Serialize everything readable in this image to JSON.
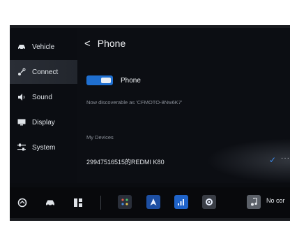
{
  "sidebar": {
    "items": [
      {
        "label": "Vehicle",
        "icon": "car-icon"
      },
      {
        "label": "Connect",
        "icon": "connect-icon",
        "active": true
      },
      {
        "label": "Sound",
        "icon": "speaker-icon"
      },
      {
        "label": "Display",
        "icon": "display-icon"
      },
      {
        "label": "System",
        "icon": "sliders-icon"
      }
    ]
  },
  "header": {
    "back_glyph": "<",
    "title": "Phone"
  },
  "phone": {
    "toggle_label": "Phone",
    "toggle_on": true,
    "discoverable_text": "Now discoverable as 'CFMOTO-8Nw6K7'"
  },
  "devices": {
    "section_label": "My Devices",
    "items": [
      {
        "name": "29947516515的REDMI K80",
        "connected": true,
        "more": "···"
      }
    ]
  },
  "dock": {
    "items": [
      "home-icon",
      "car-icon",
      "grid-icon"
    ],
    "apps": [
      "apps-grid-icon",
      "navigation-icon",
      "signal-app-icon",
      "settings-gear-icon"
    ],
    "music_icon": "music-note-icon",
    "music_text": "No cor"
  },
  "colors": {
    "accent": "#1f6fd0",
    "background": "#0c0e13",
    "check": "#3c8cf0"
  }
}
